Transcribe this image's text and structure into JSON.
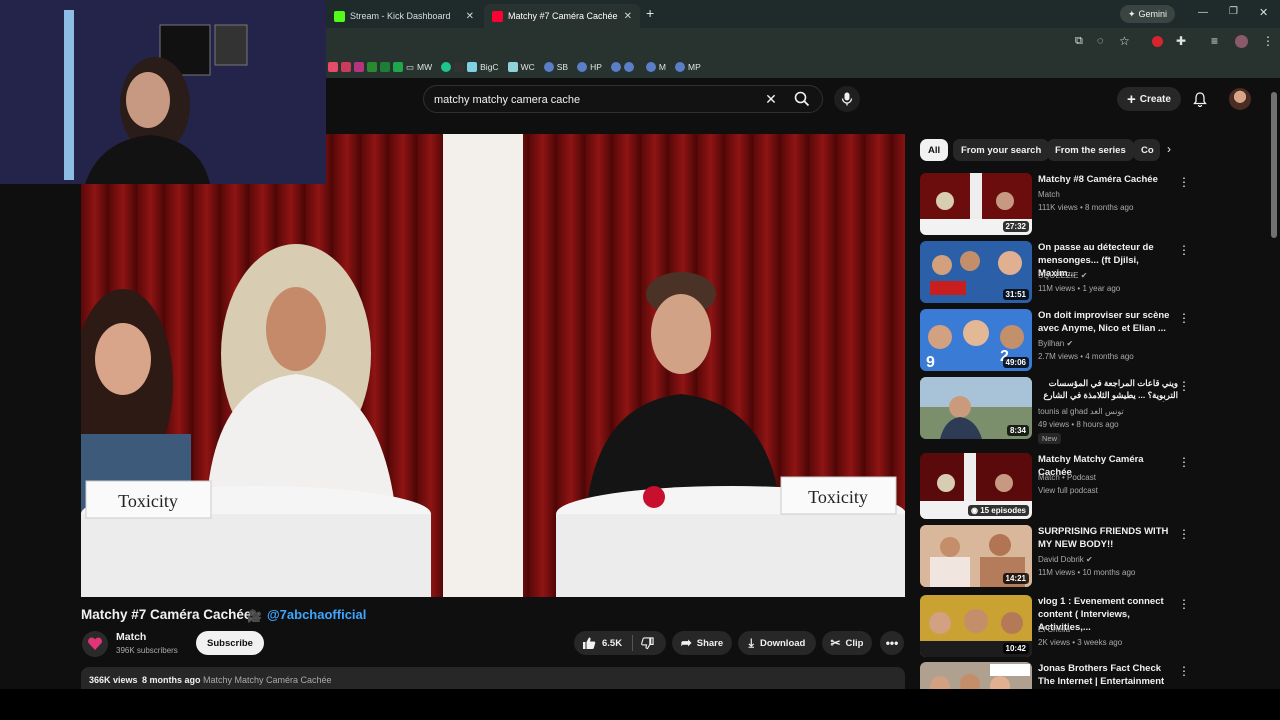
{
  "browser": {
    "tabs": [
      {
        "label": "Stream - Kick Dashboard",
        "color": "#53fc18"
      },
      {
        "label": "Matchy #7 Caméra Cachée",
        "color": "#ff0033"
      }
    ],
    "new_tab": "+",
    "gemini_label": "Gemini",
    "bookmarks": [
      "MW",
      "BigC",
      "WC",
      "SB",
      "HP",
      "M",
      "MP"
    ]
  },
  "search": {
    "query": "matchy matchy camera cache"
  },
  "header": {
    "create_label": "Create"
  },
  "chips": [
    "All",
    "From your search",
    "From the series",
    "Co"
  ],
  "player": {
    "placard_left": "Toxicity",
    "placard_right": "Toxicity"
  },
  "video": {
    "title": "Matchy #7 Caméra Cachée",
    "mention": "@7abchaofficial",
    "channel": "Match",
    "subscribers": "396K subscribers",
    "subscribe_label": "Subscribe",
    "likes": "6.5K",
    "share_label": "Share",
    "download_label": "Download",
    "clip_label": "Clip",
    "views": "366K views",
    "age": "8 months ago",
    "series": "Matchy Matchy Caméra Cachée"
  },
  "recommendations": [
    {
      "title": "Matchy #8 Caméra Cachée",
      "channel": "Match",
      "meta": "111K views • 8 months ago",
      "duration": "27:32",
      "thumb": "#6b0d0d"
    },
    {
      "title": "On passe au détecteur de mensonges... (ft Djilsi, Maxim...",
      "channel": "SQUEEZIE",
      "meta": "11M views • 1 year ago",
      "duration": "31:51",
      "thumb": "#2b5fa8"
    },
    {
      "title": "On doit improviser sur scène avec Anyme, Nico et Elian ...",
      "channel": "Byilhan",
      "meta": "2.7M views • 4 months ago",
      "duration": "49:06",
      "thumb": "#3a7bd5"
    },
    {
      "title": "ويني قاعات المراجعة في المؤسسات التربوية؟ ... يطيشو الثلامذة في الشارع في أحسان",
      "channel": "tounis al ghad تونس الغد",
      "meta": "49 views • 8 hours ago",
      "duration": "8:34",
      "thumb": "#7b8f6d",
      "badge": "New"
    },
    {
      "title": "Matchy Matchy Caméra Cachée",
      "channel": "Match • Podcast",
      "meta": "View full podcast",
      "duration": "15 episodes",
      "thumb": "#5a0a0a"
    },
    {
      "title": "SURPRISING FRIENDS WITH MY NEW BODY!!",
      "channel": "David Dobrik",
      "meta": "11M views • 10 months ago",
      "duration": "14:21",
      "thumb": "#c48c6a"
    },
    {
      "title": "vlog 1 : Evenement connect content ( Interviews, Activities,...",
      "channel": "El Chella",
      "meta": "2K views • 3 weeks ago",
      "duration": "10:42",
      "thumb": "#c9a233"
    },
    {
      "title": "Jonas Brothers Fact Check The Internet | Entertainment Weekly",
      "channel": "",
      "meta": "",
      "duration": "",
      "thumb": "#b0a090"
    }
  ]
}
